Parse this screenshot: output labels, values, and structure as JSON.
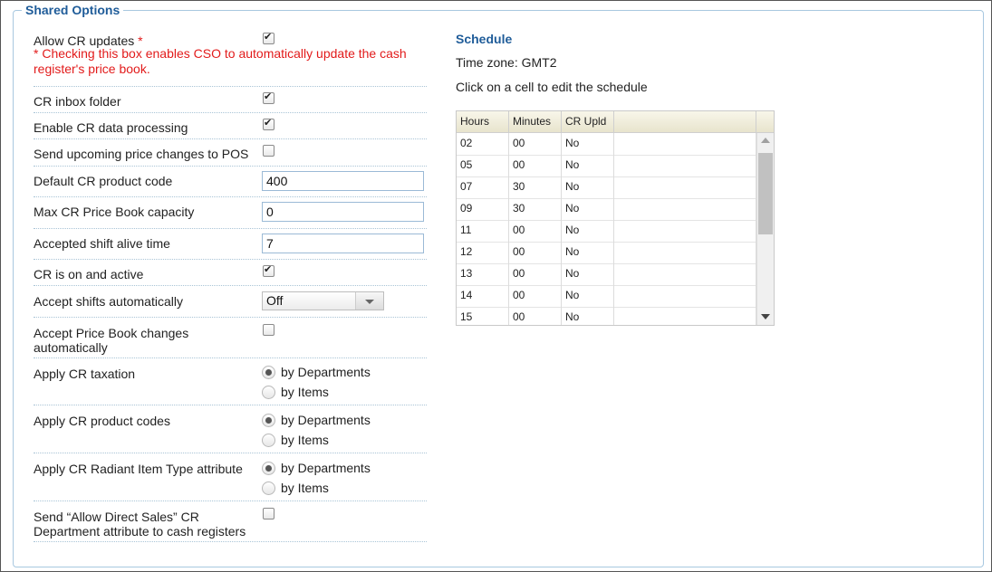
{
  "section": {
    "title": "Shared Options"
  },
  "options": {
    "allow_cr_updates": {
      "label": "Allow CR updates",
      "required_mark": "*",
      "checked": true,
      "note": "* Checking this box enables CSO to automatically update the cash register's price book."
    },
    "cr_inbox_folder": {
      "label": "CR inbox folder",
      "checked": true
    },
    "enable_cr_data_processing": {
      "label": "Enable CR data processing",
      "checked": true
    },
    "send_upcoming_price_changes": {
      "label": "Send upcoming price changes to POS",
      "checked": false
    },
    "default_cr_product_code": {
      "label": "Default CR product code",
      "value": "400"
    },
    "max_cr_price_book_capacity": {
      "label": "Max CR Price Book capacity",
      "value": "0"
    },
    "accepted_shift_alive_time": {
      "label": "Accepted shift alive time",
      "value": "7"
    },
    "cr_on_active": {
      "label": "CR is on and active",
      "checked": true
    },
    "accept_shifts_automatically": {
      "label": "Accept shifts automatically",
      "selected": "Off"
    },
    "accept_price_book_changes": {
      "label": "Accept Price Book changes automatically",
      "checked": false
    },
    "apply_cr_taxation": {
      "label": "Apply CR taxation",
      "options": [
        "by Departments",
        "by Items"
      ],
      "selected": "by Departments"
    },
    "apply_cr_product_codes": {
      "label": "Apply CR product codes",
      "options": [
        "by Departments",
        "by Items"
      ],
      "selected": "by Departments"
    },
    "apply_cr_radiant_item_type": {
      "label": "Apply CR Radiant Item Type attribute",
      "options": [
        "by Departments",
        "by Items"
      ],
      "selected": "by Departments"
    },
    "send_allow_direct_sales": {
      "label": "Send “Allow Direct Sales” CR Department attribute to cash registers",
      "checked": false
    }
  },
  "schedule": {
    "title": "Schedule",
    "timezone": "Time zone: GMT2",
    "help": "Click on a cell to edit the schedule",
    "columns": [
      "Hours",
      "Minutes",
      "CR Upld"
    ],
    "rows": [
      [
        "02",
        "00",
        "No"
      ],
      [
        "05",
        "00",
        "No"
      ],
      [
        "07",
        "30",
        "No"
      ],
      [
        "09",
        "30",
        "No"
      ],
      [
        "11",
        "00",
        "No"
      ],
      [
        "12",
        "00",
        "No"
      ],
      [
        "13",
        "00",
        "No"
      ],
      [
        "14",
        "00",
        "No"
      ],
      [
        "15",
        "00",
        "No"
      ]
    ]
  }
}
